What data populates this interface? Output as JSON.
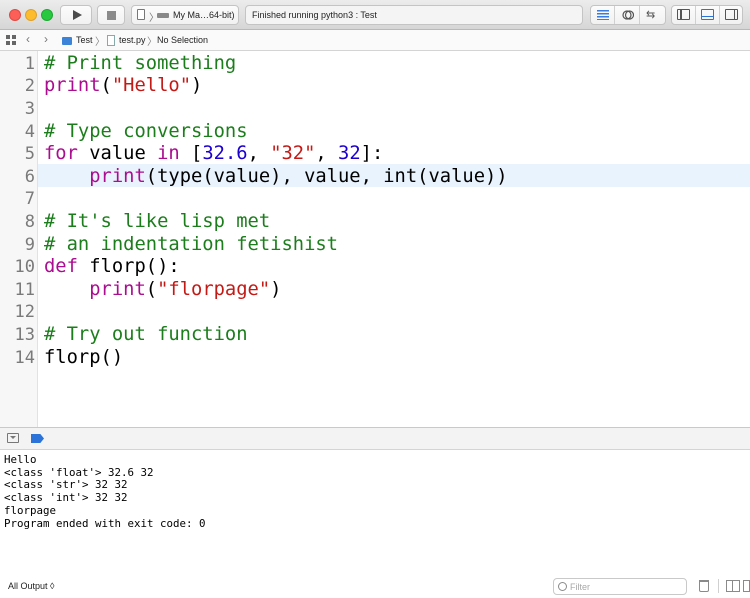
{
  "toolbar": {
    "scheme_label": "My Ma…64-bit)",
    "activity_status": "Finished running python3 : Test"
  },
  "jumpbar": {
    "project": "Test",
    "file": "test.py",
    "selection": "No Selection"
  },
  "editor": {
    "current_line": 6,
    "lines": [
      {
        "num": "1",
        "tokens": [
          {
            "t": "# Print something",
            "c": "com"
          }
        ]
      },
      {
        "num": "2",
        "tokens": [
          {
            "t": "print",
            "c": "fn"
          },
          {
            "t": "(",
            "c": ""
          },
          {
            "t": "\"Hello\"",
            "c": "str"
          },
          {
            "t": ")",
            "c": ""
          }
        ]
      },
      {
        "num": "3",
        "tokens": []
      },
      {
        "num": "4",
        "tokens": [
          {
            "t": "# Type conversions",
            "c": "com"
          }
        ]
      },
      {
        "num": "5",
        "tokens": [
          {
            "t": "for",
            "c": "kw"
          },
          {
            "t": " value ",
            "c": ""
          },
          {
            "t": "in",
            "c": "kw"
          },
          {
            "t": " [",
            "c": ""
          },
          {
            "t": "32.6",
            "c": "num"
          },
          {
            "t": ", ",
            "c": ""
          },
          {
            "t": "\"32\"",
            "c": "str"
          },
          {
            "t": ", ",
            "c": ""
          },
          {
            "t": "32",
            "c": "num"
          },
          {
            "t": "]:",
            "c": ""
          }
        ]
      },
      {
        "num": "6",
        "tokens": [
          {
            "t": "    ",
            "c": ""
          },
          {
            "t": "print",
            "c": "fn"
          },
          {
            "t": "(type(value), value, int(value))",
            "c": ""
          }
        ]
      },
      {
        "num": "7",
        "tokens": []
      },
      {
        "num": "8",
        "tokens": [
          {
            "t": "# It's like lisp met",
            "c": "com"
          }
        ]
      },
      {
        "num": "9",
        "tokens": [
          {
            "t": "# an indentation fetishist",
            "c": "com"
          }
        ]
      },
      {
        "num": "10",
        "tokens": [
          {
            "t": "def",
            "c": "kw"
          },
          {
            "t": " florp():",
            "c": ""
          }
        ]
      },
      {
        "num": "11",
        "tokens": [
          {
            "t": "    ",
            "c": ""
          },
          {
            "t": "print",
            "c": "fn"
          },
          {
            "t": "(",
            "c": ""
          },
          {
            "t": "\"florpage\"",
            "c": "str"
          },
          {
            "t": ")",
            "c": ""
          }
        ]
      },
      {
        "num": "12",
        "tokens": []
      },
      {
        "num": "13",
        "tokens": [
          {
            "t": "# Try out function",
            "c": "com"
          }
        ]
      },
      {
        "num": "14",
        "tokens": [
          {
            "t": "florp()",
            "c": ""
          }
        ]
      }
    ]
  },
  "console": {
    "lines": [
      "Hello",
      "<class 'float'> 32.6 32",
      "<class 'str'> 32 32",
      "<class 'int'> 32 32",
      "florpage",
      "Program ended with exit code: 0"
    ]
  },
  "bottombar": {
    "output_selector": "All Output ◊",
    "filter_placeholder": "Filter"
  },
  "icons": {
    "run": "play-icon",
    "stop": "stop-icon",
    "editor_standard": "standard-editor-icon",
    "editor_assistant": "assistant-editor-icon",
    "editor_version": "version-editor-icon",
    "panel_left": "navigator-panel-icon",
    "panel_bottom": "debug-panel-icon",
    "panel_right": "utilities-panel-icon"
  },
  "colors": {
    "comment": "#1c7d1c",
    "keyword": "#ab0d90",
    "string": "#c41a16",
    "number": "#1c00cf",
    "current_line_highlight": "#e9f3fd",
    "accent": "#2b73d9"
  }
}
